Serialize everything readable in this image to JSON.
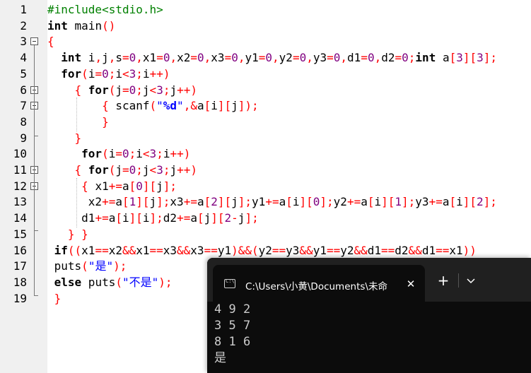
{
  "editor": {
    "lines": [
      {
        "no": "1",
        "tokens": [
          {
            "t": "#include<stdio.h>",
            "c": "pp"
          }
        ]
      },
      {
        "no": "2",
        "tokens": [
          {
            "t": "int",
            "c": "kw"
          },
          {
            "t": " main",
            "c": "id"
          },
          {
            "t": "()",
            "c": "op"
          }
        ]
      },
      {
        "no": "3",
        "tokens": [
          {
            "t": "{",
            "c": "op"
          }
        ]
      },
      {
        "no": "4",
        "tokens": [
          {
            "t": "  int",
            "c": "kw"
          },
          {
            "t": " i",
            "c": "id"
          },
          {
            "t": ",",
            "c": "op"
          },
          {
            "t": "j",
            "c": "id"
          },
          {
            "t": ",",
            "c": "op"
          },
          {
            "t": "s",
            "c": "id"
          },
          {
            "t": "=",
            "c": "op"
          },
          {
            "t": "0",
            "c": "num"
          },
          {
            "t": ",",
            "c": "op"
          },
          {
            "t": "x1",
            "c": "id"
          },
          {
            "t": "=",
            "c": "op"
          },
          {
            "t": "0",
            "c": "num"
          },
          {
            "t": ",",
            "c": "op"
          },
          {
            "t": "x2",
            "c": "id"
          },
          {
            "t": "=",
            "c": "op"
          },
          {
            "t": "0",
            "c": "num"
          },
          {
            "t": ",",
            "c": "op"
          },
          {
            "t": "x3",
            "c": "id"
          },
          {
            "t": "=",
            "c": "op"
          },
          {
            "t": "0",
            "c": "num"
          },
          {
            "t": ",",
            "c": "op"
          },
          {
            "t": "y1",
            "c": "id"
          },
          {
            "t": "=",
            "c": "op"
          },
          {
            "t": "0",
            "c": "num"
          },
          {
            "t": ",",
            "c": "op"
          },
          {
            "t": "y2",
            "c": "id"
          },
          {
            "t": "=",
            "c": "op"
          },
          {
            "t": "0",
            "c": "num"
          },
          {
            "t": ",",
            "c": "op"
          },
          {
            "t": "y3",
            "c": "id"
          },
          {
            "t": "=",
            "c": "op"
          },
          {
            "t": "0",
            "c": "num"
          },
          {
            "t": ",",
            "c": "op"
          },
          {
            "t": "d1",
            "c": "id"
          },
          {
            "t": "=",
            "c": "op"
          },
          {
            "t": "0",
            "c": "num"
          },
          {
            "t": ",",
            "c": "op"
          },
          {
            "t": "d2",
            "c": "id"
          },
          {
            "t": "=",
            "c": "op"
          },
          {
            "t": "0",
            "c": "num"
          },
          {
            "t": ";",
            "c": "op"
          },
          {
            "t": "int",
            "c": "kw"
          },
          {
            "t": " a",
            "c": "id"
          },
          {
            "t": "[",
            "c": "op"
          },
          {
            "t": "3",
            "c": "num"
          },
          {
            "t": "][",
            "c": "op"
          },
          {
            "t": "3",
            "c": "num"
          },
          {
            "t": "];",
            "c": "op"
          }
        ]
      },
      {
        "no": "5",
        "tokens": [
          {
            "t": "  for",
            "c": "kw"
          },
          {
            "t": "(",
            "c": "op"
          },
          {
            "t": "i",
            "c": "id"
          },
          {
            "t": "=",
            "c": "op"
          },
          {
            "t": "0",
            "c": "num"
          },
          {
            "t": ";",
            "c": "op"
          },
          {
            "t": "i",
            "c": "id"
          },
          {
            "t": "<",
            "c": "op"
          },
          {
            "t": "3",
            "c": "num"
          },
          {
            "t": ";",
            "c": "op"
          },
          {
            "t": "i",
            "c": "id"
          },
          {
            "t": "++)",
            "c": "op"
          }
        ]
      },
      {
        "no": "6",
        "tokens": [
          {
            "t": "    { ",
            "c": "op"
          },
          {
            "t": "for",
            "c": "kw"
          },
          {
            "t": "(",
            "c": "op"
          },
          {
            "t": "j",
            "c": "id"
          },
          {
            "t": "=",
            "c": "op"
          },
          {
            "t": "0",
            "c": "num"
          },
          {
            "t": ";",
            "c": "op"
          },
          {
            "t": "j",
            "c": "id"
          },
          {
            "t": "<",
            "c": "op"
          },
          {
            "t": "3",
            "c": "num"
          },
          {
            "t": ";",
            "c": "op"
          },
          {
            "t": "j",
            "c": "id"
          },
          {
            "t": "++)",
            "c": "op"
          }
        ]
      },
      {
        "no": "7",
        "tokens": [
          {
            "t": "        { ",
            "c": "op"
          },
          {
            "t": "scanf",
            "c": "id"
          },
          {
            "t": "(",
            "c": "op"
          },
          {
            "t": "\"",
            "c": "str"
          },
          {
            "t": "%d",
            "c": "esc"
          },
          {
            "t": "\"",
            "c": "str"
          },
          {
            "t": ",&",
            "c": "op"
          },
          {
            "t": "a",
            "c": "id"
          },
          {
            "t": "[",
            "c": "op"
          },
          {
            "t": "i",
            "c": "id"
          },
          {
            "t": "][",
            "c": "op"
          },
          {
            "t": "j",
            "c": "id"
          },
          {
            "t": "]);",
            "c": "op"
          }
        ]
      },
      {
        "no": "8",
        "tokens": [
          {
            "t": "        }",
            "c": "op"
          }
        ]
      },
      {
        "no": "9",
        "tokens": [
          {
            "t": "    }",
            "c": "op"
          }
        ]
      },
      {
        "no": "10",
        "tokens": [
          {
            "t": "     for",
            "c": "kw"
          },
          {
            "t": "(",
            "c": "op"
          },
          {
            "t": "i",
            "c": "id"
          },
          {
            "t": "=",
            "c": "op"
          },
          {
            "t": "0",
            "c": "num"
          },
          {
            "t": ";",
            "c": "op"
          },
          {
            "t": "i",
            "c": "id"
          },
          {
            "t": "<",
            "c": "op"
          },
          {
            "t": "3",
            "c": "num"
          },
          {
            "t": ";",
            "c": "op"
          },
          {
            "t": "i",
            "c": "id"
          },
          {
            "t": "++)",
            "c": "op"
          }
        ]
      },
      {
        "no": "11",
        "tokens": [
          {
            "t": "    { ",
            "c": "op"
          },
          {
            "t": "for",
            "c": "kw"
          },
          {
            "t": "(",
            "c": "op"
          },
          {
            "t": "j",
            "c": "id"
          },
          {
            "t": "=",
            "c": "op"
          },
          {
            "t": "0",
            "c": "num"
          },
          {
            "t": ";",
            "c": "op"
          },
          {
            "t": "j",
            "c": "id"
          },
          {
            "t": "<",
            "c": "op"
          },
          {
            "t": "3",
            "c": "num"
          },
          {
            "t": ";",
            "c": "op"
          },
          {
            "t": "j",
            "c": "id"
          },
          {
            "t": "++)",
            "c": "op"
          }
        ]
      },
      {
        "no": "12",
        "tokens": [
          {
            "t": "     { ",
            "c": "op"
          },
          {
            "t": "x1",
            "c": "id"
          },
          {
            "t": "+=",
            "c": "op"
          },
          {
            "t": "a",
            "c": "id"
          },
          {
            "t": "[",
            "c": "op"
          },
          {
            "t": "0",
            "c": "num"
          },
          {
            "t": "][",
            "c": "op"
          },
          {
            "t": "j",
            "c": "id"
          },
          {
            "t": "];",
            "c": "op"
          }
        ]
      },
      {
        "no": "13",
        "tokens": [
          {
            "t": "      x2",
            "c": "id"
          },
          {
            "t": "+=",
            "c": "op"
          },
          {
            "t": "a",
            "c": "id"
          },
          {
            "t": "[",
            "c": "op"
          },
          {
            "t": "1",
            "c": "num"
          },
          {
            "t": "][",
            "c": "op"
          },
          {
            "t": "j",
            "c": "id"
          },
          {
            "t": "];",
            "c": "op"
          },
          {
            "t": "x3",
            "c": "id"
          },
          {
            "t": "+=",
            "c": "op"
          },
          {
            "t": "a",
            "c": "id"
          },
          {
            "t": "[",
            "c": "op"
          },
          {
            "t": "2",
            "c": "num"
          },
          {
            "t": "][",
            "c": "op"
          },
          {
            "t": "j",
            "c": "id"
          },
          {
            "t": "];",
            "c": "op"
          },
          {
            "t": "y1",
            "c": "id"
          },
          {
            "t": "+=",
            "c": "op"
          },
          {
            "t": "a",
            "c": "id"
          },
          {
            "t": "[",
            "c": "op"
          },
          {
            "t": "i",
            "c": "id"
          },
          {
            "t": "][",
            "c": "op"
          },
          {
            "t": "0",
            "c": "num"
          },
          {
            "t": "];",
            "c": "op"
          },
          {
            "t": "y2",
            "c": "id"
          },
          {
            "t": "+=",
            "c": "op"
          },
          {
            "t": "a",
            "c": "id"
          },
          {
            "t": "[",
            "c": "op"
          },
          {
            "t": "i",
            "c": "id"
          },
          {
            "t": "][",
            "c": "op"
          },
          {
            "t": "1",
            "c": "num"
          },
          {
            "t": "];",
            "c": "op"
          },
          {
            "t": "y3",
            "c": "id"
          },
          {
            "t": "+=",
            "c": "op"
          },
          {
            "t": "a",
            "c": "id"
          },
          {
            "t": "[",
            "c": "op"
          },
          {
            "t": "i",
            "c": "id"
          },
          {
            "t": "][",
            "c": "op"
          },
          {
            "t": "2",
            "c": "num"
          },
          {
            "t": "];",
            "c": "op"
          }
        ]
      },
      {
        "no": "14",
        "tokens": [
          {
            "t": "     d1",
            "c": "id"
          },
          {
            "t": "+=",
            "c": "op"
          },
          {
            "t": "a",
            "c": "id"
          },
          {
            "t": "[",
            "c": "op"
          },
          {
            "t": "i",
            "c": "id"
          },
          {
            "t": "][",
            "c": "op"
          },
          {
            "t": "i",
            "c": "id"
          },
          {
            "t": "];",
            "c": "op"
          },
          {
            "t": "d2",
            "c": "id"
          },
          {
            "t": "+=",
            "c": "op"
          },
          {
            "t": "a",
            "c": "id"
          },
          {
            "t": "[",
            "c": "op"
          },
          {
            "t": "j",
            "c": "id"
          },
          {
            "t": "][",
            "c": "op"
          },
          {
            "t": "2",
            "c": "num"
          },
          {
            "t": "-",
            "c": "op"
          },
          {
            "t": "j",
            "c": "id"
          },
          {
            "t": "];",
            "c": "op"
          }
        ]
      },
      {
        "no": "15",
        "tokens": [
          {
            "t": "   } }",
            "c": "op"
          }
        ]
      },
      {
        "no": "16",
        "tokens": [
          {
            "t": " if",
            "c": "kw"
          },
          {
            "t": "((",
            "c": "op"
          },
          {
            "t": "x1",
            "c": "id"
          },
          {
            "t": "==",
            "c": "op"
          },
          {
            "t": "x2",
            "c": "id"
          },
          {
            "t": "&&",
            "c": "op"
          },
          {
            "t": "x1",
            "c": "id"
          },
          {
            "t": "==",
            "c": "op"
          },
          {
            "t": "x3",
            "c": "id"
          },
          {
            "t": "&&",
            "c": "op"
          },
          {
            "t": "x3",
            "c": "id"
          },
          {
            "t": "==",
            "c": "op"
          },
          {
            "t": "y1",
            "c": "id"
          },
          {
            "t": ")&&(",
            "c": "op"
          },
          {
            "t": "y2",
            "c": "id"
          },
          {
            "t": "==",
            "c": "op"
          },
          {
            "t": "y3",
            "c": "id"
          },
          {
            "t": "&&",
            "c": "op"
          },
          {
            "t": "y1",
            "c": "id"
          },
          {
            "t": "==",
            "c": "op"
          },
          {
            "t": "y2",
            "c": "id"
          },
          {
            "t": "&&",
            "c": "op"
          },
          {
            "t": "d1",
            "c": "id"
          },
          {
            "t": "==",
            "c": "op"
          },
          {
            "t": "d2",
            "c": "id"
          },
          {
            "t": "&&",
            "c": "op"
          },
          {
            "t": "d1",
            "c": "id"
          },
          {
            "t": "==",
            "c": "op"
          },
          {
            "t": "x1",
            "c": "id"
          },
          {
            "t": "))",
            "c": "op"
          }
        ]
      },
      {
        "no": "17",
        "tokens": [
          {
            "t": " puts",
            "c": "id"
          },
          {
            "t": "(",
            "c": "op"
          },
          {
            "t": "\"是\"",
            "c": "str"
          },
          {
            "t": ");",
            "c": "op"
          }
        ]
      },
      {
        "no": "18",
        "tokens": [
          {
            "t": " else",
            "c": "kw"
          },
          {
            "t": " puts",
            "c": "id"
          },
          {
            "t": "(",
            "c": "op"
          },
          {
            "t": "\"不是\"",
            "c": "str"
          },
          {
            "t": ");",
            "c": "op"
          }
        ]
      },
      {
        "no": "19",
        "tokens": [
          {
            "t": " }",
            "c": "op"
          }
        ]
      }
    ]
  },
  "terminal": {
    "tab_title": "C:\\Users\\小黄\\Documents\\未命",
    "close_glyph": "✕",
    "new_tab_glyph": "+",
    "output_lines": [
      "4 9 2",
      "3 5 7",
      "8 1 6",
      "是"
    ]
  },
  "colors": {
    "preprocessor": "#008000",
    "keyword": "#000000",
    "operator": "#ff0000",
    "number": "#800080",
    "string": "#0000ff",
    "terminal_bg": "#0c0c0c",
    "terminal_tabbar": "#202020"
  }
}
